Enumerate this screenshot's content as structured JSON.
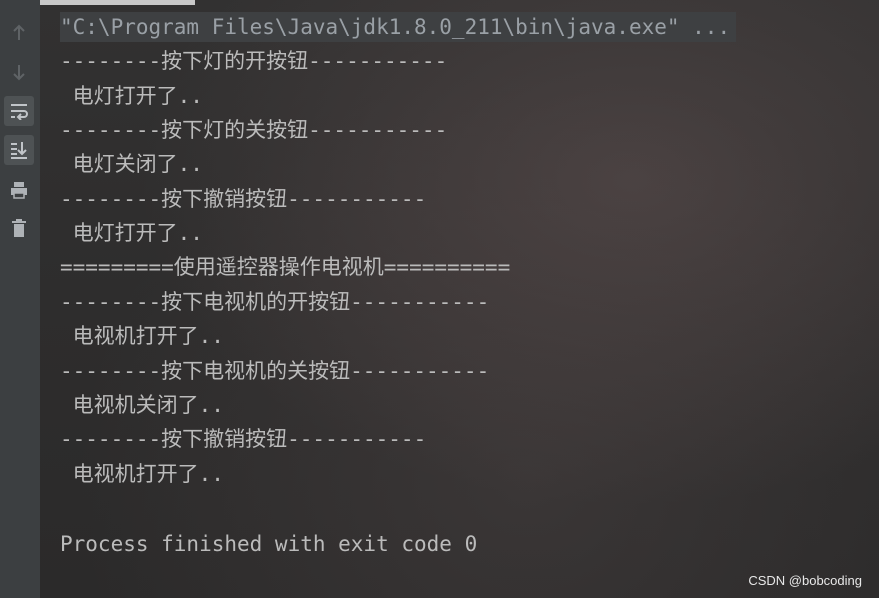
{
  "gutter": {
    "icons": [
      "arrow-up-icon",
      "arrow-down-icon",
      "soft-wrap-icon",
      "scroll-to-end-icon",
      "print-icon",
      "trash-icon"
    ]
  },
  "console": {
    "command": "\"C:\\Program Files\\Java\\jdk1.8.0_211\\bin\\java.exe\" ...",
    "lines": [
      "--------按下灯的开按钮-----------",
      " 电灯打开了..",
      "--------按下灯的关按钮-----------",
      " 电灯关闭了..",
      "--------按下撤销按钮-----------",
      " 电灯打开了..",
      "=========使用遥控器操作电视机==========",
      "--------按下电视机的开按钮-----------",
      " 电视机打开了..",
      "--------按下电视机的关按钮-----------",
      " 电视机关闭了..",
      "--------按下撤销按钮-----------",
      " 电视机打开了..",
      "",
      "Process finished with exit code 0"
    ]
  },
  "watermark": "CSDN @bobcoding"
}
